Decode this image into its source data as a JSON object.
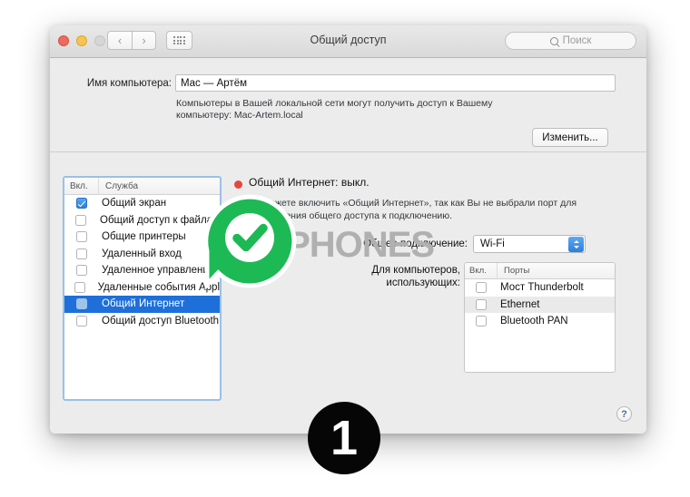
{
  "window": {
    "title": "Общий доступ",
    "search_placeholder": "Поиск",
    "traffic_lights": [
      "close",
      "minimize",
      "zoom"
    ],
    "nav_back_icon": "chevron-left-icon",
    "nav_forward_icon": "chevron-right-icon",
    "grid_icon": "grid-view-icon",
    "search_icon": "search-icon"
  },
  "computer_name": {
    "label": "Имя компьютера:",
    "value": "Mac — Артём",
    "hint": "Компьютеры в Вашей локальной сети могут получить доступ к Вашему компьютеру: Mac-Artem.local",
    "change_button": "Изменить..."
  },
  "services": {
    "header_enabled": "Вкл.",
    "header_service": "Служба",
    "items": [
      {
        "label": "Общий экран",
        "checked": true,
        "selected": false
      },
      {
        "label": "Общий доступ к файлам",
        "checked": false,
        "selected": false
      },
      {
        "label": "Общие принтеры",
        "checked": false,
        "selected": false
      },
      {
        "label": "Удаленный вход",
        "checked": false,
        "selected": false
      },
      {
        "label": "Удаленное управление",
        "checked": false,
        "selected": false
      },
      {
        "label": "Удаленные события Appl",
        "checked": false,
        "selected": false
      },
      {
        "label": "Общий Интернет",
        "checked": false,
        "selected": true
      },
      {
        "label": "Общий доступ Bluetooth",
        "checked": false,
        "selected": false
      }
    ]
  },
  "detail": {
    "status_title": "Общий Интернет: выкл.",
    "status_color": "#e8453c",
    "description": "Вы не можете включить «Общий Интернет», так как Вы не выбрали порт для предоставления общего доступа к подключению.",
    "connection_label": "Общее подключение:",
    "connection_value": "Wi-Fi",
    "computers_label_line1": "Для компьютеров,",
    "computers_label_line2": "использующих:",
    "ports_header_enabled": "Вкл.",
    "ports_header_ports": "Порты",
    "ports": [
      {
        "label": "Мост Thunderbolt",
        "checked": false
      },
      {
        "label": "Ethernet",
        "checked": false
      },
      {
        "label": "Bluetooth PAN",
        "checked": false
      }
    ]
  },
  "help": {
    "label": "?"
  },
  "overlays": {
    "watermark_text": "IPHONES",
    "watermark_color": "#b0b0b0",
    "check_badge_color": "#1db954",
    "check_badge_icon": "checkmark-circle-icon",
    "step_number": "1"
  }
}
